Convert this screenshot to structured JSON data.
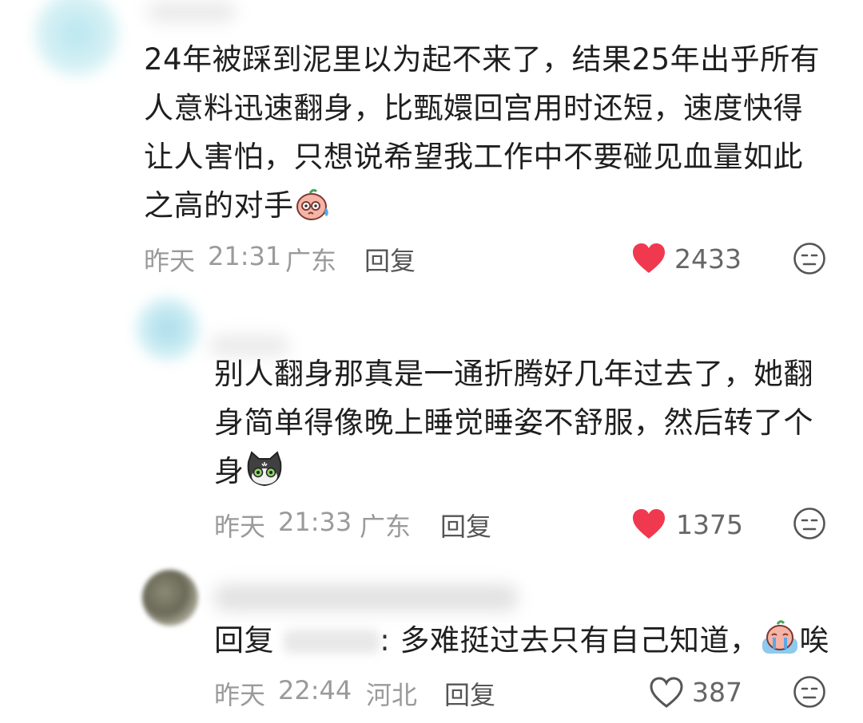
{
  "comments": [
    {
      "text": "24年被踩到泥里以为起不来了，结果25年出乎所有人意料迅速翻身，比甄嬛回宫用时还短，速度快得让人害怕，只想说希望我工作中不要碰见血量如此之高的对手",
      "date": "昨天",
      "time": "21:31",
      "location": "广东",
      "reply_label": "回复",
      "likes": "2433",
      "liked": true,
      "emoji": "sweat-face-emoji"
    },
    {
      "text": "别人翻身那真是一通折腾好几年过去了，她翻身简单得像晚上睡觉睡姿不舒服，然后转了个身",
      "date": "昨天",
      "time": "21:33",
      "location": "广东",
      "reply_label": "回复",
      "likes": "1375",
      "liked": true,
      "emoji": "cat-shocked-emoji"
    },
    {
      "reply_prefix": "回复",
      "colon_text": ": 多难挺过去只有自己知道，",
      "suffix": "唉",
      "date": "昨天",
      "time": "22:44",
      "location": "河北",
      "reply_label": "回复",
      "likes": "387",
      "liked": false,
      "emoji": "crying-face-emoji"
    }
  ],
  "colors": {
    "heart_liked": "#f0394f",
    "text_main": "#1f1f1f",
    "text_meta": "#9a9a9a"
  }
}
